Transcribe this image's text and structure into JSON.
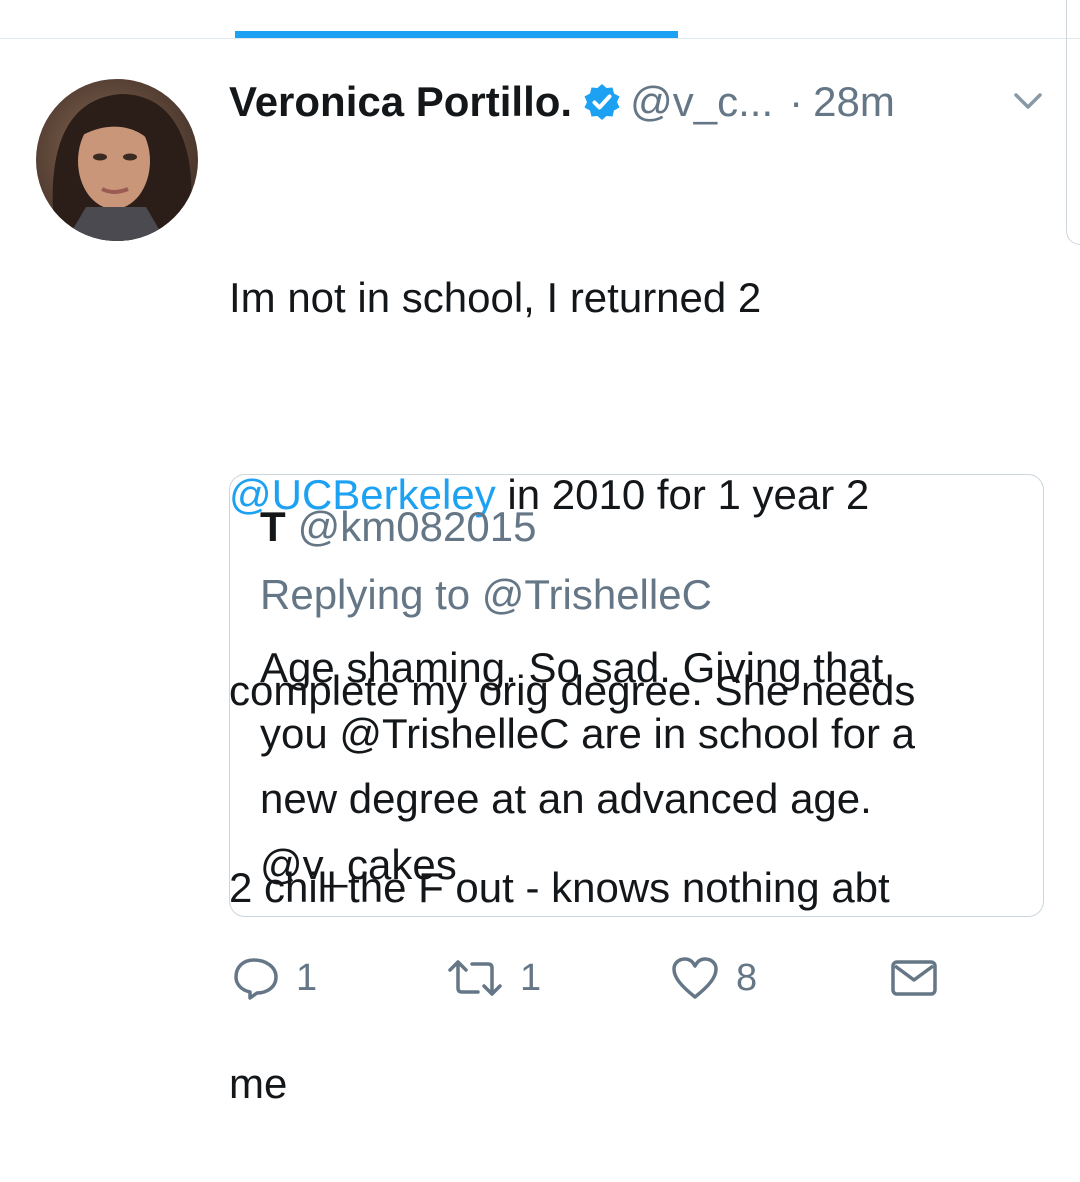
{
  "tweet": {
    "author_name": "Veronica Portillo.",
    "handle": "@v_c...",
    "separator": "·",
    "time": "28m",
    "text_lines": [
      {
        "before": "Im not in school, I returned 2",
        "mention": "",
        "after": ""
      },
      {
        "before": "",
        "mention": "@UCBerkeley",
        "after": " in 2010 for 1 year 2"
      },
      {
        "before": "complete my orig degree. She needs",
        "mention": "",
        "after": ""
      },
      {
        "before": "2 chill the F out - knows nothing abt",
        "mention": "",
        "after": ""
      },
      {
        "before": "me",
        "mention": "",
        "after": ""
      }
    ]
  },
  "quoted": {
    "author_name": "T",
    "handle": "@km082015",
    "replying_to": "Replying to @TrishelleC",
    "text": "Age shaming. So sad. Giving that\nyou @TrishelleC are in school for a\nnew degree at an advanced age.\n@v_cakes"
  },
  "actions": {
    "reply_count": "1",
    "retweet_count": "1",
    "like_count": "8"
  },
  "icons": {
    "verified": "verified-badge-icon",
    "chevron": "chevron-down-icon",
    "reply": "reply-icon",
    "retweet": "retweet-icon",
    "like": "heart-icon",
    "dm": "envelope-icon"
  },
  "colors": {
    "accent": "#1da1f2",
    "secondary_text": "#657786",
    "primary_text": "#14171a"
  }
}
